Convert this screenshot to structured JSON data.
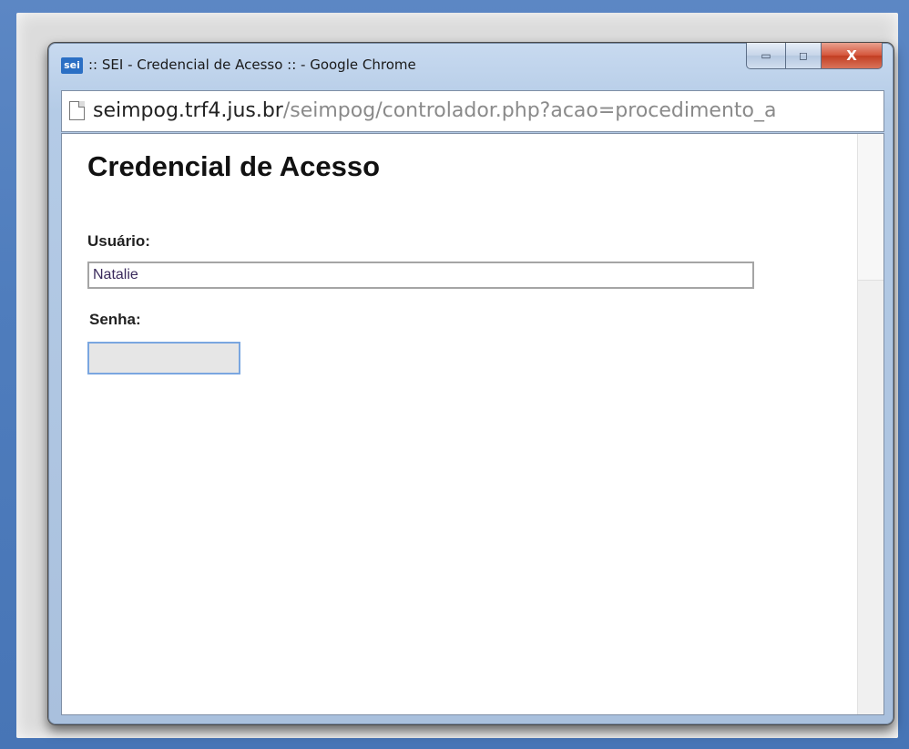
{
  "window": {
    "title": ":: SEI - Credencial de Acesso :: - Google Chrome",
    "app_icon": "sei",
    "controls": {
      "minimize": "▭",
      "maximize": "◻",
      "close": "X"
    }
  },
  "address_bar": {
    "host": "seimpog.trf4.jus.br",
    "path": "/seimpog/controlador.php?acao=procedimento_a"
  },
  "page": {
    "heading": "Credencial de Acesso",
    "user_label": "Usuário:",
    "user_value": "Natalie",
    "password_label": "Senha:",
    "password_value": ""
  }
}
